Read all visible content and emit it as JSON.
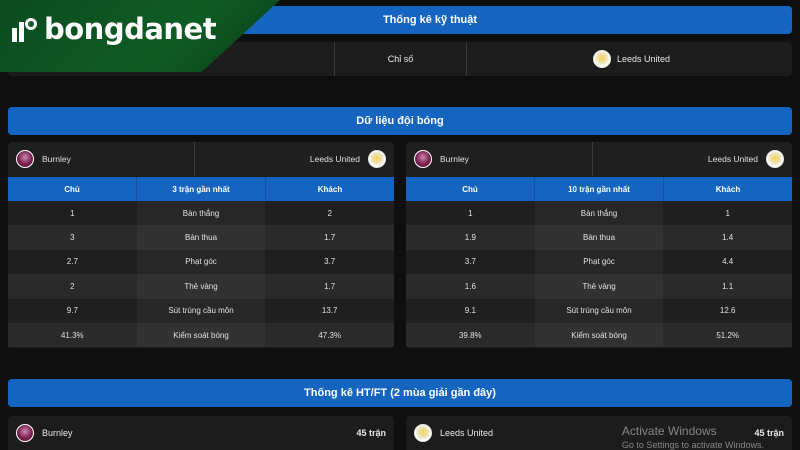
{
  "logo": {
    "brand": "bongdanet"
  },
  "tech": {
    "title": "Thống kê kỹ thuật",
    "col_mid": "Chỉ số",
    "team_right": "Leeds United"
  },
  "team_data": {
    "title": "Dữ liệu đội bóng",
    "left_panel": {
      "home_team": "Burnley",
      "away_team": "Leeds United",
      "headers": [
        "Chủ",
        "3 trận gần nhất",
        "Khách"
      ],
      "rows": [
        [
          "1",
          "Bàn thắng",
          "2"
        ],
        [
          "3",
          "Bàn thua",
          "1.7"
        ],
        [
          "2.7",
          "Phạt góc",
          "3.7"
        ],
        [
          "2",
          "Thẻ vàng",
          "1.7"
        ],
        [
          "9.7",
          "Sút trúng cầu môn",
          "13.7"
        ],
        [
          "41.3%",
          "Kiểm soát bóng",
          "47.3%"
        ]
      ]
    },
    "right_panel": {
      "home_team": "Burnley",
      "away_team": "Leeds United",
      "headers": [
        "Chủ",
        "10 trận gần nhất",
        "Khách"
      ],
      "rows": [
        [
          "1",
          "Bàn thắng",
          "1"
        ],
        [
          "1.9",
          "Bàn thua",
          "1.4"
        ],
        [
          "3.7",
          "Phạt góc",
          "4.4"
        ],
        [
          "1.6",
          "Thẻ vàng",
          "1.1"
        ],
        [
          "9.1",
          "Sút trúng cầu môn",
          "12.6"
        ],
        [
          "39.8%",
          "Kiểm soát bóng",
          "51.2%"
        ]
      ]
    }
  },
  "htft": {
    "title": "Thống kê HT/FT (2 mùa giải gần đây)",
    "left_team": "Burnley",
    "left_count": "45 trận",
    "right_team": "Leeds United",
    "right_count": "45 trận"
  },
  "watermark": {
    "line1": "Activate Windows",
    "line2": "Go to Settings to activate Windows."
  }
}
